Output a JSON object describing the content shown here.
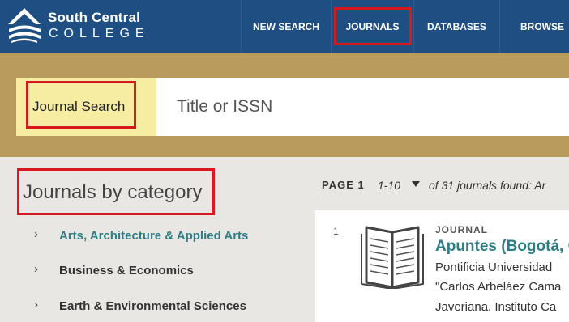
{
  "header": {
    "brand_line1": "South Central",
    "brand_line2": "COLLEGE",
    "nav": [
      "NEW SEARCH",
      "JOURNALS",
      "DATABASES",
      "BROWSE"
    ]
  },
  "search": {
    "label": "Journal Search",
    "placeholder": "Title or ISSN"
  },
  "categories": {
    "heading": "Journals by category",
    "items": [
      {
        "label": "Arts, Architecture & Applied Arts",
        "active": true
      },
      {
        "label": "Business & Economics",
        "active": false
      },
      {
        "label": "Earth & Environmental Sciences",
        "active": false
      }
    ]
  },
  "results": {
    "page_label": "PAGE 1",
    "range": "1-10",
    "count_text": "of 31 journals found: Ar",
    "items": [
      {
        "number": "1",
        "type": "JOURNAL",
        "title": "Apuntes (Bogotá, C",
        "publisher_lines": [
          "Pontificia Universidad",
          "\"Carlos Arbeláez Cama",
          "Javeriana. Instituto Ca"
        ]
      }
    ]
  },
  "colors": {
    "header_bg": "#1f4e82",
    "search_band": "#b99b5d",
    "label_bg": "#f6eda3",
    "accent_teal": "#2e7d86",
    "highlight_red": "#d7191f"
  },
  "icons": {
    "logo": "south-central-logo-icon",
    "journal": "open-book-icon",
    "chevron": "chevron-right-icon",
    "caret": "caret-down-icon"
  }
}
